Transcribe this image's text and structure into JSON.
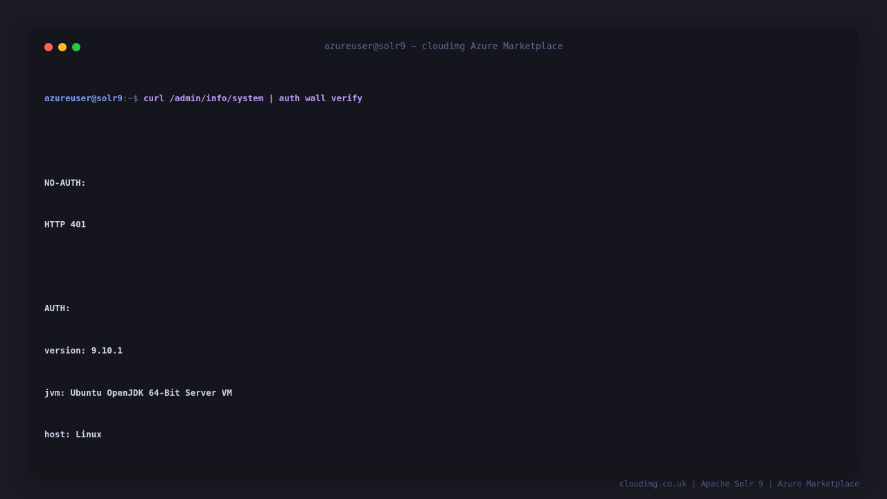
{
  "window": {
    "title": "azureuser@solr9 ~ cloudimg Azure Marketplace"
  },
  "terminal": {
    "prompt_user": "azureuser@solr9",
    "prompt_path": ":~$",
    "command": "curl /admin/info/system | auth wall verify",
    "output": [
      "",
      "NO-AUTH:",
      "HTTP 401",
      "",
      "AUTH:",
      "version: 9.10.1",
      "jvm: Ubuntu OpenJDK 64-Bit Server VM",
      "host: Linux"
    ]
  },
  "footer": {
    "text": "cloudimg.co.uk | Apache Solr 9 | Azure Marketplace"
  },
  "colors": {
    "background": "#1b1b24",
    "window": "#15151d",
    "close_dot": "#ff5f57",
    "minimize_dot": "#febc2e",
    "maximize_dot": "#28c840",
    "prompt_user": "#7aa2f7",
    "command": "#bb9af7",
    "output_text": "#d2d6ec"
  }
}
